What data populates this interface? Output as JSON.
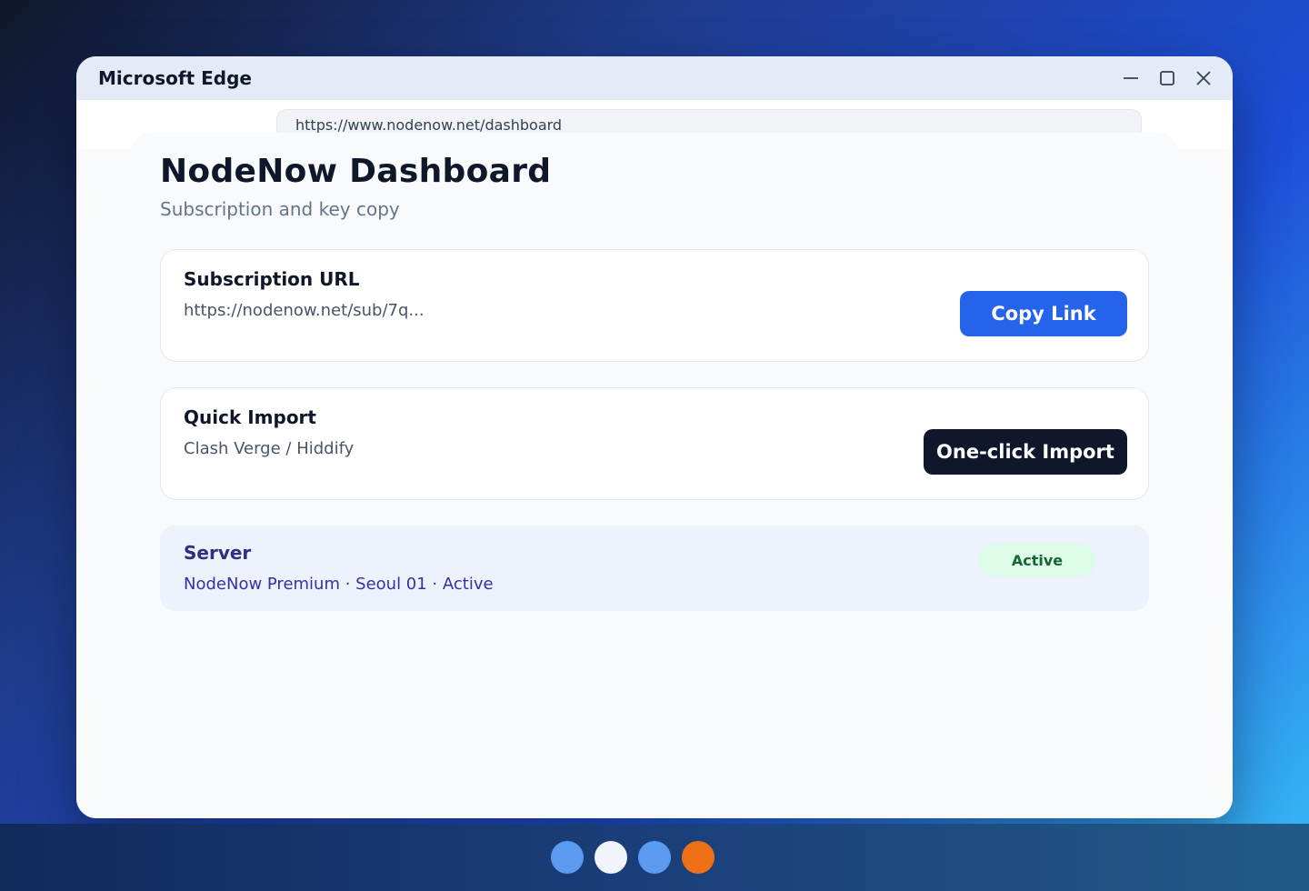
{
  "window": {
    "title": "Microsoft Edge",
    "controls": [
      "minimize-icon",
      "maximize-icon",
      "close-icon"
    ]
  },
  "browser": {
    "url": "https://www.nodenow.net/dashboard"
  },
  "page": {
    "title": "NodeNow Dashboard",
    "subtitle": "Subscription and key copy"
  },
  "subscription": {
    "title": "Subscription URL",
    "url": "https://nodenow.net/sub/7q...",
    "button": "Copy Link"
  },
  "quick_import": {
    "title": "Quick Import",
    "clients": "Clash Verge / Hiddify",
    "button": "One-click Import"
  },
  "server": {
    "title": "Server",
    "details": "NodeNow Premium · Seoul 01 · Active",
    "status": "Active"
  },
  "taskbar": {
    "apps": [
      {
        "icon": "app-icon-blue",
        "color": "#5b9bf0"
      },
      {
        "icon": "app-icon-white",
        "color": "#f1f5f9"
      },
      {
        "icon": "app-icon-blue-2",
        "color": "#5b9bf0"
      },
      {
        "icon": "app-icon-orange",
        "color": "#f07018"
      }
    ]
  },
  "colors": {
    "accent": "#2563eb",
    "dark_button": "#0f172a",
    "status_green": "#dcfce7"
  }
}
